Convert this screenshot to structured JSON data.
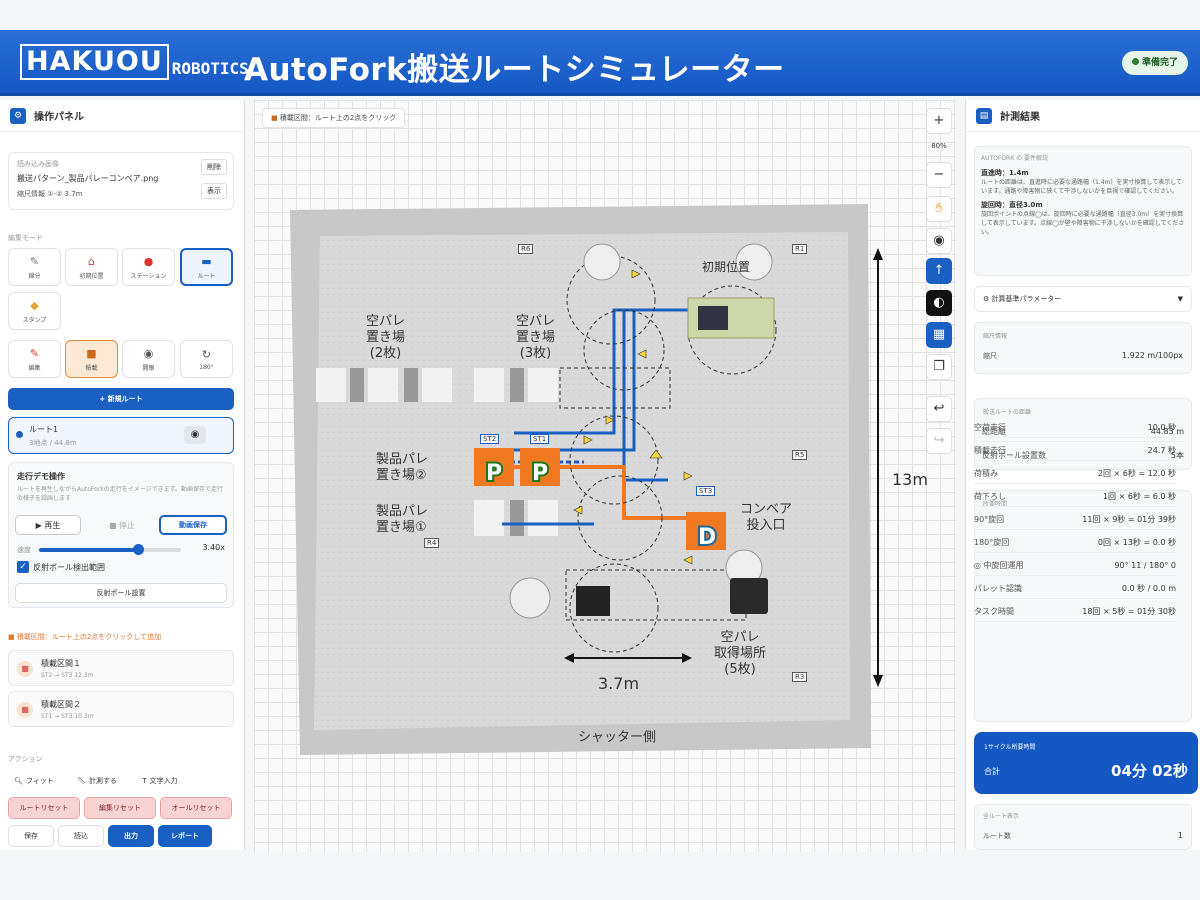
{
  "header": {
    "logo_main": "HAKUOU",
    "logo_sub": "ROBOTICS",
    "title": "AutoFork搬送ルートシミュレーター",
    "status": "準備完了"
  },
  "left": {
    "title": "操作パネル",
    "file": {
      "section": "読み込み画像",
      "name": "搬送パターン_製品パレーコンベア.png",
      "scale": "縮尺情報 ①-② 3.7m",
      "delete": "削除",
      "show": "表示"
    },
    "mode_label": "編集モード",
    "tools": [
      {
        "label": "線分",
        "icon": "pencil-icon"
      },
      {
        "label": "初期位置",
        "icon": "home-icon"
      },
      {
        "label": "ステーション",
        "icon": "pin-icon"
      },
      {
        "label": "ルート",
        "icon": "route-icon"
      },
      {
        "label": "スタンプ",
        "icon": "stamp-icon"
      }
    ],
    "tools2": [
      {
        "label": "編集",
        "icon": "edit-icon"
      },
      {
        "label": "積載",
        "icon": "box-icon"
      },
      {
        "label": "開眼",
        "icon": "eye-icon"
      },
      {
        "label": "180°",
        "icon": "rotate-icon"
      }
    ],
    "new_route": "+ 新規ルート",
    "route": {
      "name": "ルート1",
      "sub": "3地点 / 44.8m"
    },
    "demo": {
      "title": "走行デモ操作",
      "desc": "ルートを再生しながらAutoForkの走行をイメージできます。動画保存で走行の様子を録画します",
      "play": "▶ 再生",
      "stop": "■ 停止",
      "save": "動画保存",
      "speed_label": "速度",
      "speed": "3.40x",
      "speed_frac": 0.7,
      "checkbox": "反射ポール検出範囲",
      "pole_btn": "反射ポール設置"
    },
    "load_hint": "積載区間：ルート上の2点をクリックして追加",
    "loads": [
      {
        "name": "積載区間１",
        "sub": "ST2 → ST3 12.3m"
      },
      {
        "name": "積載区間２",
        "sub": "ST1 → ST3 10.3m"
      }
    ],
    "actions": {
      "label": "アクション",
      "fit": "フィット",
      "measure": "計測する",
      "text": "文字入力",
      "route_reset": "ルートリセット",
      "edit_reset": "編集リセット",
      "all_reset": "オールリセット",
      "save": "保存",
      "load": "読込",
      "output": "出力",
      "report": "レポート"
    }
  },
  "canvas": {
    "hint": "積載区間：ルート上の2点をクリック",
    "zoom": "80%",
    "labels": {
      "empty_pallet2": "空パレ\n置き場\n(2枚)",
      "empty_pallet3": "空パレ\n置き場\n(3枚)",
      "prod2": "製品パレ\n置き場②",
      "prod1": "製品パレ\n置き場①",
      "initial": "初期位置",
      "conveyor": "コンベア\n投入口",
      "empty_get": "空パレ\n取得場所\n(5枚)",
      "shutter": "シャッター側",
      "dim_h": "3.7m",
      "dim_v": "13m"
    },
    "poles": [
      "R6",
      "R1",
      "R5",
      "R4",
      "R3"
    ],
    "stations": [
      "ST2",
      "ST1",
      "ST3"
    ]
  },
  "right": {
    "title": "計測結果",
    "notes": {
      "head": "AUTOFORK の 要件解説",
      "l1": "直進時：1.4m",
      "l1d": "ルートの距離は、直進時に必要な通路幅（1.4m）を実寸換算して表示しています。通路や障害物に狭くて干渉しないかを目視で確認してください。",
      "l2": "旋回時：直径3.0m",
      "l2d": "旋回ポイントの点線◯は、旋回時に必要な通路幅（直径3.0m）を実寸換算して表示しています。点線◯が壁や障害物に干渉しないかを確認してください。"
    },
    "param": "⚙ 計算基準パラメーター",
    "scale": {
      "title": "縮尺情報",
      "k": "縮尺",
      "v": "1.922 m/100px"
    },
    "route": {
      "title": "搬送ルートの距離",
      "rows": [
        [
          "総距離",
          "44.83 m"
        ],
        [
          "反射ポール設置数",
          "5本"
        ]
      ]
    },
    "time": {
      "title": "所要時間",
      "rows": [
        [
          "空荷走行",
          "10.0 秒"
        ],
        [
          "積載走行",
          "24.7 秒"
        ],
        [
          "荷積み",
          "2回 × 6秒 = 12.0 秒"
        ],
        [
          "荷下ろし",
          "1回 × 6秒 = 6.0 秒"
        ],
        [
          "90°旋回",
          "11回 × 9秒 = 01分 39秒"
        ],
        [
          "180°旋回",
          "0回 × 13秒 = 0.0 秒"
        ],
        [
          "◎ 中旋回運用",
          "90° 11 / 180° 0"
        ],
        [
          "パレット認識",
          "0.0 秒 / 0.0 m"
        ],
        [
          "タスク時間",
          "18回 × 5秒 = 01分 30秒"
        ]
      ]
    },
    "total": {
      "title": "1サイクル所要時間",
      "k": "合計",
      "v": "04分 02秒"
    },
    "info": {
      "title": "全ルート表示",
      "k": "ルート数",
      "v": "1"
    }
  }
}
